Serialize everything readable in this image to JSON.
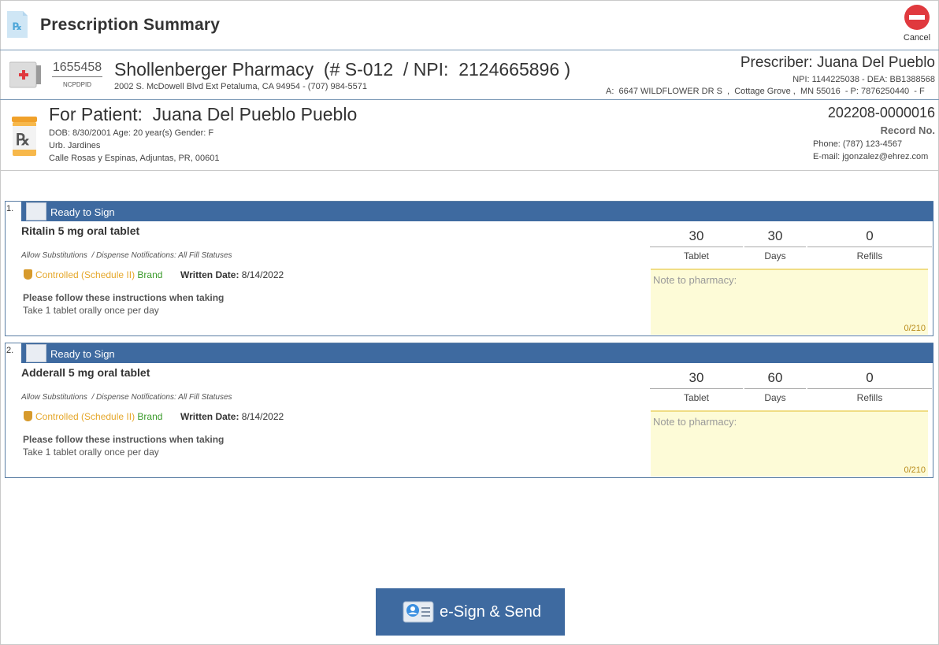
{
  "header": {
    "title": "Prescription Summary",
    "cancel_label": "Cancel"
  },
  "pharmacy": {
    "ncpdp_id": "1655458",
    "ncpdp_label": "NCPDPID",
    "name_line": "Shollenberger Pharmacy  (# S-012  / NPI:  2124665896 )",
    "address": "2002 S. McDowell Blvd Ext Petaluma, CA 94954 - (707) 984-5571"
  },
  "prescriber": {
    "name_line": "Prescriber: Juana Del Pueblo",
    "ids": "NPI: 1144225038 - DEA: BB1388568",
    "address": "A:  6647 WILDFLOWER DR S  ,  Cottage Grove ,  MN 55016  - P: 7876250440  - F"
  },
  "patient": {
    "name_line": "For Patient:  Juana Del Pueblo Pueblo",
    "demographics": "DOB:  8/30/2001  Age:  20 year(s)  Gender:  F",
    "address_line1": "Urb. Jardines",
    "address_line2": "Calle Rosas y Espinas, Adjuntas, PR, 00601",
    "record_no": "202208-0000016",
    "record_label": "Record No.",
    "phone": "Phone:  (787) 123-4567",
    "email": "E-mail: jgonzalez@ehrez.com"
  },
  "prescriptions": [
    {
      "number": "1.",
      "status": "Ready to Sign",
      "drug": "Ritalin 5 mg oral tablet",
      "substitutions": "Allow Substitutions  / Dispense Notifications: All Fill Statuses",
      "controlled": "Controlled (Schedule II)",
      "brand": "Brand",
      "written_label": "Written Date:",
      "written_date": "8/14/2022",
      "instructions_heading": "Please follow these instructions when taking",
      "instructions": "Take 1 tablet orally once per day",
      "quantity": "30",
      "quantity_unit": "Tablet",
      "days": "30",
      "days_label": "Days",
      "refills": "0",
      "refills_label": "Refills",
      "note_placeholder": "Note to pharmacy:",
      "note_counter": "0/210"
    },
    {
      "number": "2.",
      "status": "Ready to Sign",
      "drug": "Adderall 5 mg oral tablet",
      "substitutions": "Allow Substitutions  / Dispense Notifications: All Fill Statuses",
      "controlled": "Controlled (Schedule II)",
      "brand": "Brand",
      "written_label": "Written Date:",
      "written_date": "8/14/2022",
      "instructions_heading": "Please follow these instructions when taking",
      "instructions": "Take 1 tablet orally once per day",
      "quantity": "30",
      "quantity_unit": "Tablet",
      "days": "60",
      "days_label": "Days",
      "refills": "0",
      "refills_label": "Refills",
      "note_placeholder": "Note to pharmacy:",
      "note_counter": "0/210"
    }
  ],
  "footer": {
    "esign_label": "e-Sign & Send"
  },
  "colors": {
    "accent": "#3e6aa0",
    "cancel": "#e0393e",
    "note_bg": "#fdfbd7",
    "controlled": "#e5a72b",
    "brand": "#3a9a2a"
  }
}
